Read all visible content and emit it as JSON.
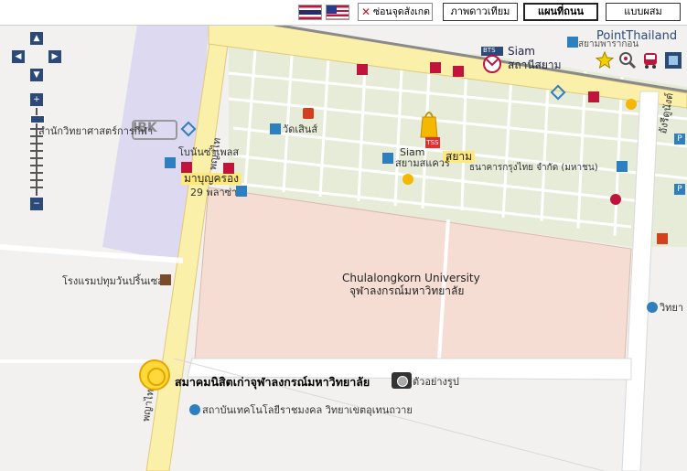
{
  "toolbar": {
    "hide_poi_label": "ซ่อนจุดสังเกต",
    "map_modes": [
      {
        "label": "ภาพดาวเทียม",
        "active": false
      },
      {
        "label": "แผนที่ถนน",
        "active": true
      },
      {
        "label": "แบบผสม",
        "active": false
      }
    ]
  },
  "brand": "PointThailand",
  "map_labels": {
    "siam_en": "Siam",
    "siam_th_station": "สถานีสยาม",
    "siam_highlight": "สยาม",
    "siam_paragon": "สยามพารากอน",
    "siam_cut": "Siam",
    "siam_square": "สยามสแควร์",
    "siam_bank": "ธนาคารกรุงไทย จำกัด (มหาชน)",
    "wat_pathum": "วัดเสินส์",
    "science_office": "สำนักวิทยาศาสตร์การกีฬา",
    "bobae": "โบนันซ่าเพลส",
    "mabunkrong": "มาบุญครอง",
    "plaza29": "29 พลาซ่า",
    "hotel_pathumwan": "โรงแรมปทุมวันปริ้นเซส",
    "chula_en": "Chulalongkorn University",
    "chula_th": "จุฬาลงกรณ์มหาวิทยาลัย",
    "alumni": "สมาคมนิสิตเก่าจุฬาลงกรณ์มหาวิทยาลัย",
    "example_photo": "ตัวอย่างรูป",
    "tech_institute": "สถาบันเทคโนโลยีราชมงคล วิทยาเขตอุเทนถวาย",
    "science_right": "วิทยา",
    "phayathai_top": "พญาไท",
    "phayathai_bottom": "พญาไท",
    "henri_dunant": "อังรีดูนังต์",
    "ibk": "IBK",
    "bts": "BTS",
    "tss": "TSS",
    "road_rama1": "พระราม"
  },
  "colors": {
    "land": "#f2f1ef",
    "block": "#e6ecd8",
    "campus": "#f5ddd3",
    "mbk_zone": "#ddd9f1",
    "main_road": "#fbf0a9",
    "road_edge": "#e0c97a",
    "brand_blue": "#2b4a7a"
  }
}
